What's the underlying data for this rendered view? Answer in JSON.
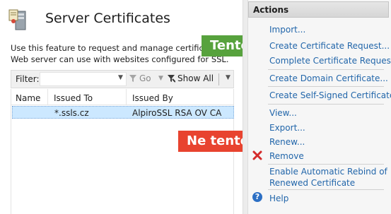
{
  "page": {
    "title": "Server Certificates",
    "description_line1": "Use this feature to request and manage certificates",
    "description_line2": "Web server can use with websites configured for SSL."
  },
  "toolbar": {
    "filter_label": "Filter:",
    "filter_value": "",
    "go_label": "Go",
    "show_all_label": "Show All"
  },
  "grid": {
    "columns": [
      "Name",
      "Issued To",
      "Issued By"
    ],
    "rows": [
      {
        "name": "",
        "issued_to": "*.ssls.cz",
        "issued_by": "AlpiroSSL RSA OV CA"
      }
    ]
  },
  "actions": {
    "header": "Actions",
    "items": [
      "Import...",
      "Create Certificate Request...",
      "Complete Certificate Request...",
      "Create Domain Certificate...",
      "Create Self-Signed Certificate...",
      "View...",
      "Export...",
      "Renew...",
      "Remove",
      "Enable Automatic Rebind of",
      "Renewed Certificate",
      "Help"
    ]
  },
  "callouts": {
    "green": "Tento",
    "red": "Ne tento"
  },
  "colors": {
    "link": "#2266aa",
    "selection": "#cce8ff",
    "callout_green": "#57a23d",
    "callout_red": "#e8432f"
  }
}
